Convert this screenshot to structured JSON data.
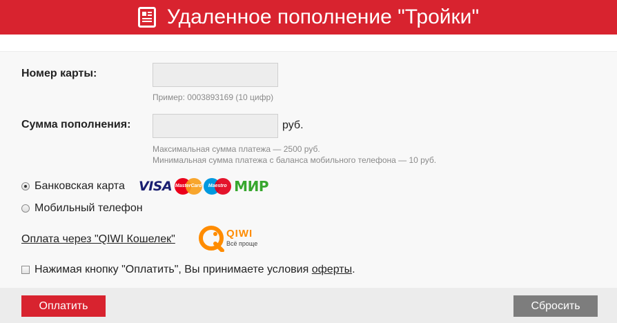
{
  "header": {
    "title": "Удаленное пополнение \"Тройки\"",
    "icon": "document-icon"
  },
  "form": {
    "card_number": {
      "label": "Номер карты:",
      "value": "",
      "hint": "Пример: 0003893169 (10 цифр)"
    },
    "amount": {
      "label": "Сумма пополнения:",
      "value": "",
      "unit": "руб.",
      "hint_max": "Максимальная сумма платежа — 2500 руб.",
      "hint_min": "Минимальная сумма платежа с баланса мобильного телефона — 10 руб."
    },
    "payment_methods": [
      {
        "label": "Банковская карта",
        "selected": true
      },
      {
        "label": "Мобильный телефон",
        "selected": false
      }
    ],
    "card_logos": {
      "visa": "VISA",
      "mastercard": "MasterCard",
      "maestro": "Maestro",
      "mir": "МИР"
    },
    "qiwi": {
      "link": "Оплата через \"QIWI Кошелек\"",
      "logo_name": "QIWI",
      "logo_tagline": "Всё проще"
    },
    "agreement": {
      "text": "Нажимая кнопку \"Оплатить\", Вы принимаете условия ",
      "link": "оферты",
      "suffix": ".",
      "checked": false
    }
  },
  "buttons": {
    "pay": "Оплатить",
    "reset": "Сбросить"
  },
  "colors": {
    "brand_red": "#d8232f",
    "reset_gray": "#7d7d7d",
    "qiwi_orange": "#ff8c00"
  }
}
